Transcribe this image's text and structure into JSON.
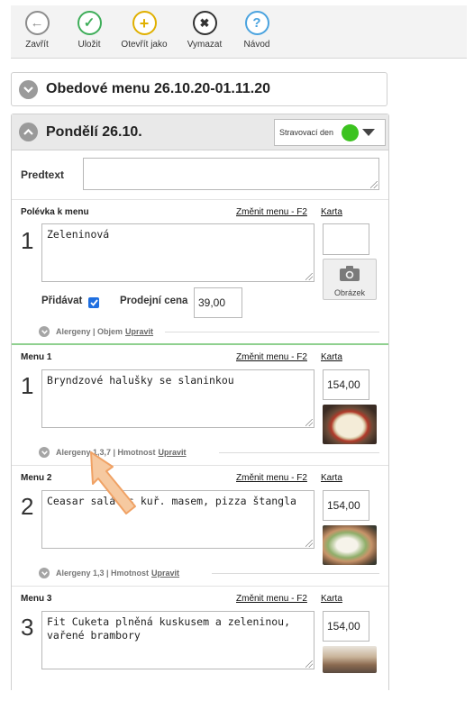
{
  "toolbar": {
    "buttons": [
      {
        "label": "Zavřít",
        "icon": "back-arrow-icon",
        "color": "#8d8d8d",
        "glyph": "←"
      },
      {
        "label": "Uložit",
        "icon": "check-icon",
        "color": "#3fae5a",
        "glyph": "✓"
      },
      {
        "label": "Otevřít jako",
        "icon": "plus-icon",
        "color": "#e0b000",
        "glyph": "+"
      },
      {
        "label": "Vymazat",
        "icon": "close-icon",
        "color": "#333333",
        "glyph": "✖"
      },
      {
        "label": "Návod",
        "icon": "help-icon",
        "color": "#4aa3df",
        "glyph": "?"
      }
    ]
  },
  "week": {
    "title": "Obedové menu 26.10.20-01.11.20"
  },
  "day": {
    "title": "Pondělí 26.10.",
    "type_select": "Stravovací den",
    "status_color": "#3cc320"
  },
  "predtext": {
    "label": "Predtext",
    "value": ""
  },
  "soup": {
    "label": "Polévka k menu",
    "change_link": "Změnit menu - F2",
    "card_link": "Karta",
    "number": "1",
    "text": "Zeleninová",
    "add_label": "Přidávat",
    "add_checked": true,
    "price_label": "Prodejní cena",
    "price": "39,00",
    "photo_label": "Obrázek",
    "allergen_text": "Alergeny | Objem",
    "edit_link": "Upravit"
  },
  "menus": [
    {
      "label": "Menu 1",
      "change_link": "Změnit menu - F2",
      "card_link": "Karta",
      "number": "1",
      "text": "Bryndzové halušky se slaninkou",
      "price": "154,00",
      "allergen_text": "Alergeny 1,3,7 | Hmotnost",
      "edit_link": "Upravit"
    },
    {
      "label": "Menu 2",
      "change_link": "Změnit menu - F2",
      "card_link": "Karta",
      "number": "2",
      "text": "Ceasar salát s kuř. masem, pizza štangla",
      "price": "154,00",
      "allergen_text": "Alergeny 1,3 | Hmotnost",
      "edit_link": "Upravit"
    },
    {
      "label": "Menu 3",
      "change_link": "Změnit menu - F2",
      "card_link": "Karta",
      "number": "3",
      "text": "Fit Cuketa plněná kuskusem a zeleninou,\nvařené brambory",
      "price": "154,00"
    }
  ]
}
